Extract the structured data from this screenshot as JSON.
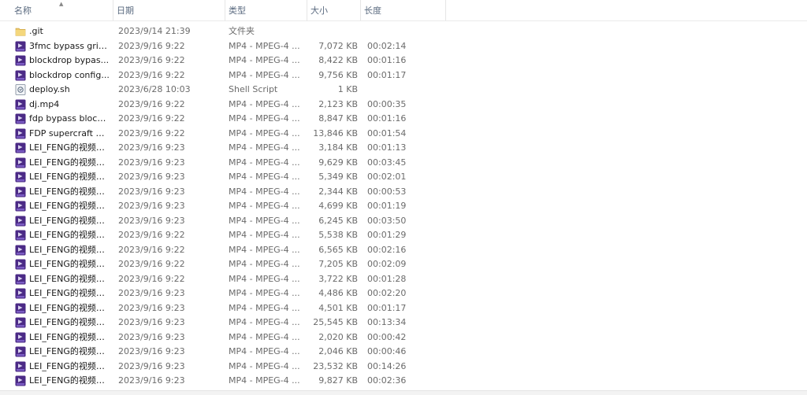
{
  "columns": {
    "name": "名称",
    "date": "日期",
    "type": "类型",
    "size": "大小",
    "length": "长度"
  },
  "rows": [
    {
      "icon": "folder-icon",
      "name": ".git",
      "date": "2023/9/14 21:39",
      "type": "文件夹",
      "size": "",
      "length": ""
    },
    {
      "icon": "video-file-icon",
      "name": "3fmc bypass grim...",
      "date": "2023/9/16 9:22",
      "type": "MP4 - MPEG-4 ...",
      "size": "7,072 KB",
      "length": "00:02:14"
    },
    {
      "icon": "video-file-icon",
      "name": "blockdrop bypas...",
      "date": "2023/9/16 9:22",
      "type": "MP4 - MPEG-4 ...",
      "size": "8,422 KB",
      "length": "00:01:16"
    },
    {
      "icon": "video-file-icon",
      "name": "blockdrop config...",
      "date": "2023/9/16 9:22",
      "type": "MP4 - MPEG-4 ...",
      "size": "9,756 KB",
      "length": "00:01:17"
    },
    {
      "icon": "script-file-icon",
      "name": "deploy.sh",
      "date": "2023/6/28 10:03",
      "type": "Shell Script",
      "size": "1 KB",
      "length": ""
    },
    {
      "icon": "video-file-icon",
      "name": "dj.mp4",
      "date": "2023/9/16 9:22",
      "type": "MP4 - MPEG-4 ...",
      "size": "2,123 KB",
      "length": "00:00:35"
    },
    {
      "icon": "video-file-icon",
      "name": "fdp bypass block...",
      "date": "2023/9/16 9:22",
      "type": "MP4 - MPEG-4 ...",
      "size": "8,847 KB",
      "length": "00:01:16"
    },
    {
      "icon": "video-file-icon",
      "name": "FDP supercraft by...",
      "date": "2023/9/16 9:22",
      "type": "MP4 - MPEG-4 ...",
      "size": "13,846 KB",
      "length": "00:01:54"
    },
    {
      "icon": "video-file-icon",
      "name": "LEI_FENG的视频列...",
      "date": "2023/9/16 9:23",
      "type": "MP4 - MPEG-4 ...",
      "size": "3,184 KB",
      "length": "00:01:13"
    },
    {
      "icon": "video-file-icon",
      "name": "LEI_FENG的视频列...",
      "date": "2023/9/16 9:23",
      "type": "MP4 - MPEG-4 ...",
      "size": "9,629 KB",
      "length": "00:03:45"
    },
    {
      "icon": "video-file-icon",
      "name": "LEI_FENG的视频列...",
      "date": "2023/9/16 9:23",
      "type": "MP4 - MPEG-4 ...",
      "size": "5,349 KB",
      "length": "00:02:01"
    },
    {
      "icon": "video-file-icon",
      "name": "LEI_FENG的视频列...",
      "date": "2023/9/16 9:23",
      "type": "MP4 - MPEG-4 ...",
      "size": "2,344 KB",
      "length": "00:00:53"
    },
    {
      "icon": "video-file-icon",
      "name": "LEI_FENG的视频列...",
      "date": "2023/9/16 9:23",
      "type": "MP4 - MPEG-4 ...",
      "size": "4,699 KB",
      "length": "00:01:19"
    },
    {
      "icon": "video-file-icon",
      "name": "LEI_FENG的视频列...",
      "date": "2023/9/16 9:23",
      "type": "MP4 - MPEG-4 ...",
      "size": "6,245 KB",
      "length": "00:03:50"
    },
    {
      "icon": "video-file-icon",
      "name": "LEI_FENG的视频列...",
      "date": "2023/9/16 9:22",
      "type": "MP4 - MPEG-4 ...",
      "size": "5,538 KB",
      "length": "00:01:29"
    },
    {
      "icon": "video-file-icon",
      "name": "LEI_FENG的视频列...",
      "date": "2023/9/16 9:22",
      "type": "MP4 - MPEG-4 ...",
      "size": "6,565 KB",
      "length": "00:02:16"
    },
    {
      "icon": "video-file-icon",
      "name": "LEI_FENG的视频列...",
      "date": "2023/9/16 9:22",
      "type": "MP4 - MPEG-4 ...",
      "size": "7,205 KB",
      "length": "00:02:09"
    },
    {
      "icon": "video-file-icon",
      "name": "LEI_FENG的视频列...",
      "date": "2023/9/16 9:22",
      "type": "MP4 - MPEG-4 ...",
      "size": "3,722 KB",
      "length": "00:01:28"
    },
    {
      "icon": "video-file-icon",
      "name": "LEI_FENG的视频列...",
      "date": "2023/9/16 9:23",
      "type": "MP4 - MPEG-4 ...",
      "size": "4,486 KB",
      "length": "00:02:20"
    },
    {
      "icon": "video-file-icon",
      "name": "LEI_FENG的视频列...",
      "date": "2023/9/16 9:23",
      "type": "MP4 - MPEG-4 ...",
      "size": "4,501 KB",
      "length": "00:01:17"
    },
    {
      "icon": "video-file-icon",
      "name": "LEI_FENG的视频列...",
      "date": "2023/9/16 9:23",
      "type": "MP4 - MPEG-4 ...",
      "size": "25,545 KB",
      "length": "00:13:34"
    },
    {
      "icon": "video-file-icon",
      "name": "LEI_FENG的视频列...",
      "date": "2023/9/16 9:23",
      "type": "MP4 - MPEG-4 ...",
      "size": "2,020 KB",
      "length": "00:00:42"
    },
    {
      "icon": "video-file-icon",
      "name": "LEI_FENG的视频列...",
      "date": "2023/9/16 9:23",
      "type": "MP4 - MPEG-4 ...",
      "size": "2,046 KB",
      "length": "00:00:46"
    },
    {
      "icon": "video-file-icon",
      "name": "LEI_FENG的视频列...",
      "date": "2023/9/16 9:23",
      "type": "MP4 - MPEG-4 ...",
      "size": "23,532 KB",
      "length": "00:14:26"
    },
    {
      "icon": "video-file-icon",
      "name": "LEI_FENG的视频列...",
      "date": "2023/9/16 9:23",
      "type": "MP4 - MPEG-4 ...",
      "size": "9,827 KB",
      "length": "00:02:36"
    }
  ]
}
